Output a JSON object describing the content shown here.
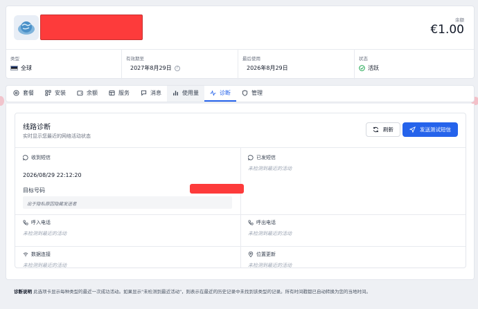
{
  "header": {
    "balance_label": "余额",
    "balance_value": "€1.00",
    "info": [
      {
        "label": "类型",
        "value": "全球"
      },
      {
        "label": "有效期至",
        "value": "2027年8月29日"
      },
      {
        "label": "最后使用",
        "value": "2026年8月29日"
      },
      {
        "label": "状态",
        "value": "活跃"
      }
    ]
  },
  "tabs": [
    {
      "label": "套餐",
      "icon": "package-icon"
    },
    {
      "label": "安装",
      "icon": "qr-code-icon"
    },
    {
      "label": "余额",
      "icon": "wallet-icon"
    },
    {
      "label": "服务",
      "icon": "grid-icon"
    },
    {
      "label": "消息",
      "icon": "message-icon"
    },
    {
      "label": "使用量",
      "icon": "bar-chart-icon"
    },
    {
      "label": "诊断",
      "icon": "activity-icon"
    },
    {
      "label": "管理",
      "icon": "shield-icon"
    }
  ],
  "active_tab": "诊断",
  "diagnostics": {
    "title": "线路诊断",
    "subtitle": "实时显示您最近的网络活动状态",
    "refresh_label": "刷新",
    "send_test_label": "发送测试短信",
    "received_sms": {
      "title": "收到短信",
      "timestamp": "2026/08/29 22:12:20",
      "target_label": "目标号码",
      "hidden_sender_note": "出于隐私原因隐藏发送者"
    },
    "sent_sms": {
      "title": "已发短信",
      "status": "未检测到最近的活动"
    },
    "incoming_call": {
      "title": "呼入电话",
      "status": "未检测到最近的活动"
    },
    "outgoing_call": {
      "title": "呼出电话",
      "status": "未检测到最近的活动"
    },
    "data_connection": {
      "title": "数据连接",
      "status": "未检测到最近的活动"
    },
    "location_update": {
      "title": "位置更新",
      "status": "未检测到最近的活动"
    }
  },
  "footnote": {
    "bold": "诊断说明",
    "text": "此选项卡显示每种类型的最近一次成功活动。如果显示\"未检测到最近活动\"，则表示在最近的历史记录中未找到该类型的记录。所有时间戳都已自动转换为您的当地时间。"
  },
  "colors": {
    "accent": "#2563eb",
    "success": "#16a34a",
    "redaction": "#fd3b3b"
  }
}
